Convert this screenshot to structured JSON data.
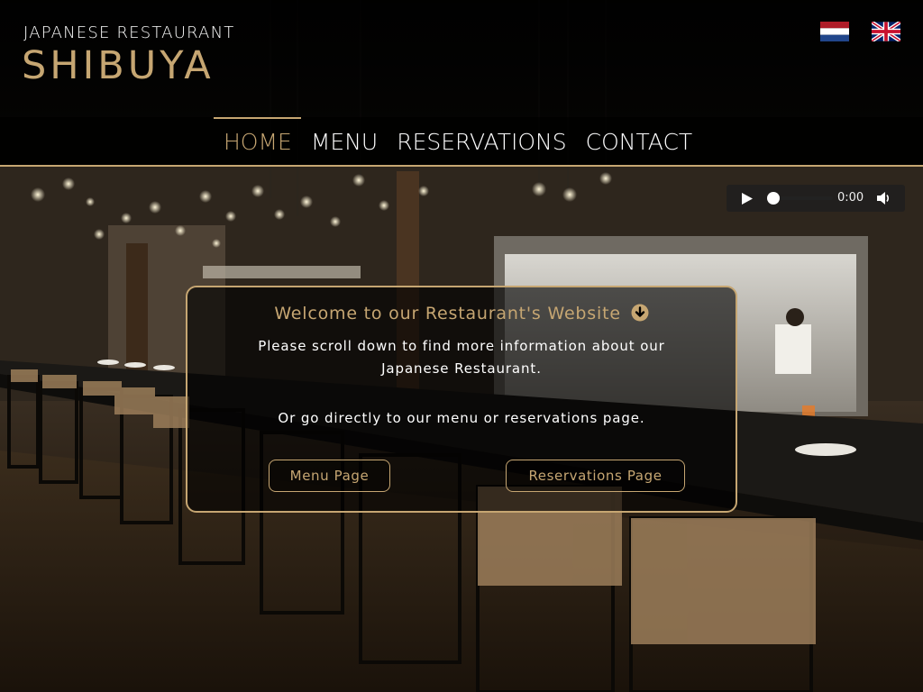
{
  "header": {
    "subtitle": "JAPANESE RESTAURANT",
    "name": "SHIBUYA"
  },
  "languages": [
    {
      "name": "Dutch",
      "icon": "netherlands-flag-icon"
    },
    {
      "name": "English",
      "icon": "united-kingdom-flag-icon"
    }
  ],
  "nav": {
    "items": [
      {
        "label": "HOME",
        "active": true
      },
      {
        "label": "MENU",
        "active": false
      },
      {
        "label": "RESERVATIONS",
        "active": false
      },
      {
        "label": "CONTACT",
        "active": false
      }
    ]
  },
  "audio": {
    "time": "0:00",
    "icons": [
      "play-icon",
      "volume-icon"
    ]
  },
  "welcome": {
    "title": "Welcome to our Restaurant's Website",
    "line1": "Please scroll down to find more information about our Japanese Restaurant.",
    "line2": "Or go directly to our menu or reservations page.",
    "menu_button": "Menu Page",
    "reservations_button": "Reservations Page"
  },
  "colors": {
    "accent": "#c6a672",
    "nav_bg": "#000000",
    "text": "#ffffff"
  }
}
